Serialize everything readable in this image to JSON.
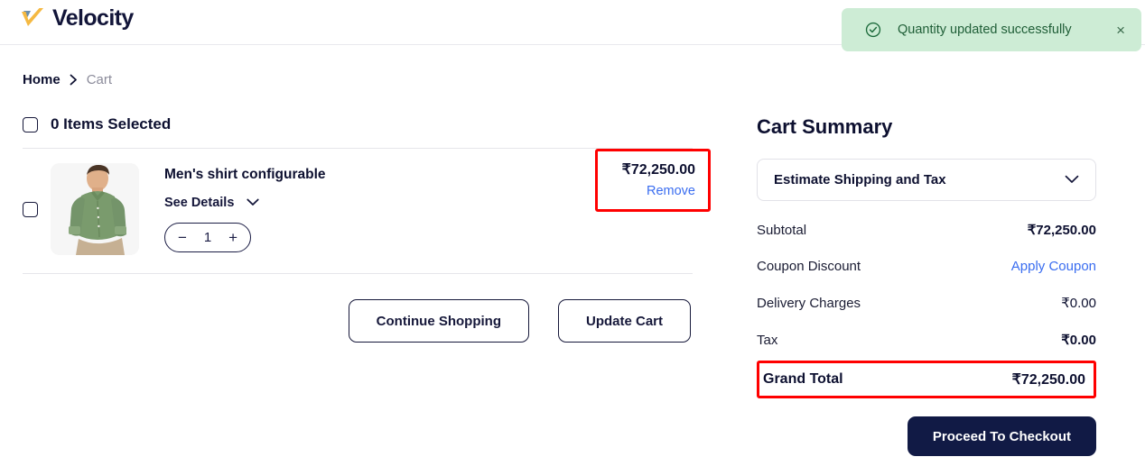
{
  "header": {
    "brand_name": "Velocity",
    "logo_icon": "velocity-check-logo",
    "logo_primary_color": "#f5b942",
    "logo_secondary_color": "#6b8fae"
  },
  "toast": {
    "icon": "check-circle-icon",
    "message": "Quantity updated successfully",
    "close_label": "×",
    "bg_color": "#cdecd5",
    "text_color": "#1f5e37"
  },
  "breadcrumb": {
    "home": "Home",
    "separator_icon": "chevron-right-icon",
    "current": "Cart"
  },
  "cart": {
    "select_all_label": "0 Items Selected",
    "items": [
      {
        "title": "Men's shirt configurable",
        "see_details_label": "See Details",
        "details_chevron_icon": "chevron-down-icon",
        "qty_decrease": "−",
        "qty_value": "1",
        "qty_increase": "+",
        "price": "₹72,250.00",
        "remove_label": "Remove",
        "image_alt": "man wearing green button-up shirt"
      }
    ],
    "continue_shopping_label": "Continue Shopping",
    "update_cart_label": "Update Cart"
  },
  "summary": {
    "title": "Cart Summary",
    "estimate_label": "Estimate Shipping and Tax",
    "estimate_chevron_icon": "chevron-down-icon",
    "rows": [
      {
        "label": "Subtotal",
        "value": "₹72,250.00",
        "kind": "value"
      },
      {
        "label": "Coupon Discount",
        "value": "Apply Coupon",
        "kind": "link"
      },
      {
        "label": "Delivery Charges",
        "value": "₹0.00",
        "kind": "value"
      },
      {
        "label": "Tax",
        "value": "₹0.00",
        "kind": "value"
      }
    ],
    "grand_total_label": "Grand Total",
    "grand_total_value": "₹72,250.00",
    "checkout_label": "Proceed To Checkout",
    "highlight_color": "#ff0000",
    "link_color": "#3a6df0",
    "primary_button_color": "#111a45"
  }
}
